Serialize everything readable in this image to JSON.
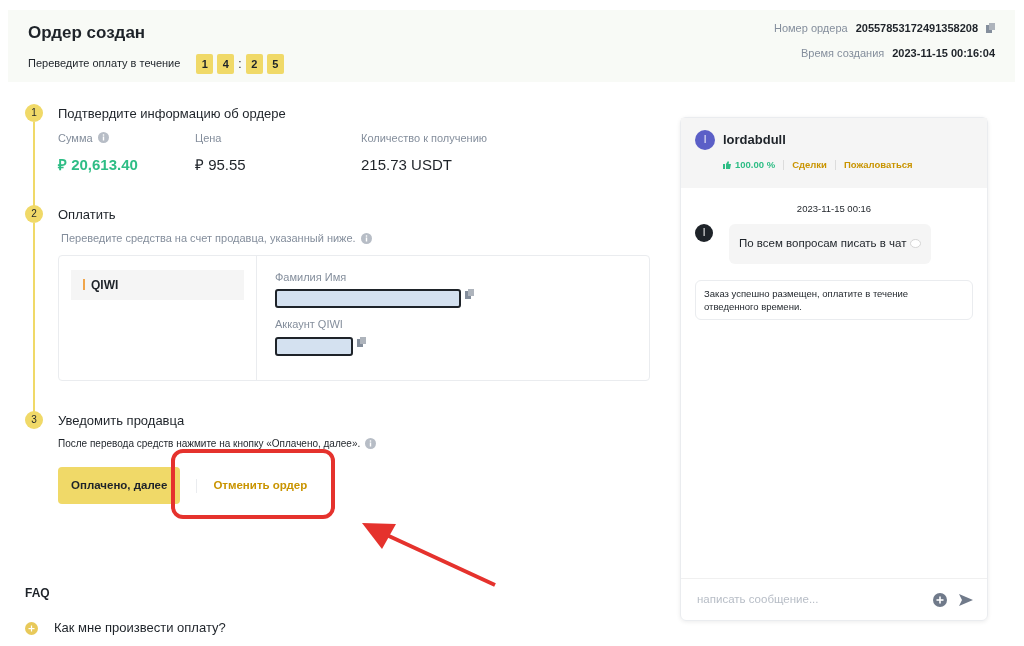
{
  "header": {
    "title": "Ордер создан",
    "timer_label": "Переведите оплату в течение",
    "timer": [
      {
        "kind": "digit",
        "text": "1"
      },
      {
        "kind": "digit",
        "text": "4"
      },
      {
        "kind": "separator",
        "text": ":"
      },
      {
        "kind": "digit",
        "text": "2"
      },
      {
        "kind": "digit",
        "text": "5"
      }
    ],
    "order_number_label": "Номер ордера",
    "order_number": "20557853172491358208",
    "created_label": "Время создания",
    "created": "2023-11-15 00:16:04"
  },
  "steps": [
    {
      "number": "1",
      "title": "Подтвердите информацию об ордере",
      "kind": "info",
      "fields": [
        {
          "label": "Сумма",
          "value": "₽ 20,613.40",
          "highlight": true,
          "info": true
        },
        {
          "label": "Цена",
          "value": "₽ 95.55",
          "highlight": false,
          "info": false
        },
        {
          "label": "Количество к получению",
          "value": "215.73 USDT",
          "highlight": false,
          "info": false
        }
      ]
    },
    {
      "number": "2",
      "title": "Оплатить",
      "kind": "payment",
      "note": "Переведите средства на счет продавца, указанный ниже.",
      "method": "QIWI",
      "details": [
        {
          "label": "Фамилия Имя"
        },
        {
          "label": "Аккаунт QIWI"
        }
      ]
    },
    {
      "number": "3",
      "title": "Уведомить продавца",
      "kind": "notify",
      "note": "После перевода средств нажмите на кнопку «Оплачено, далее».",
      "buttons": [
        {
          "label": "Оплачено, далее",
          "kind": "primary",
          "annotated": false
        },
        {
          "label": "Отменить ордер",
          "kind": "link",
          "annotated": true
        }
      ]
    }
  ],
  "faq": {
    "title": "FAQ",
    "items": [
      {
        "question": "Как мне произвести оплату?",
        "expanded": false
      }
    ]
  },
  "chat": {
    "user": "lordabdull",
    "avatar_letter": "l",
    "rating": "100.00 %",
    "links": [
      "Сделки",
      "Пожаловаться"
    ],
    "messages": [
      {
        "kind": "date",
        "text": "2023-11-15 00:16"
      },
      {
        "kind": "incoming",
        "avatar_letter": "l",
        "text": "По всем вопросам писать в чат"
      },
      {
        "kind": "system",
        "text": "Заказ успешно размещен, оплатите в течение отведенного времени."
      }
    ],
    "input": {
      "placeholder": "написать сообщение..."
    }
  }
}
